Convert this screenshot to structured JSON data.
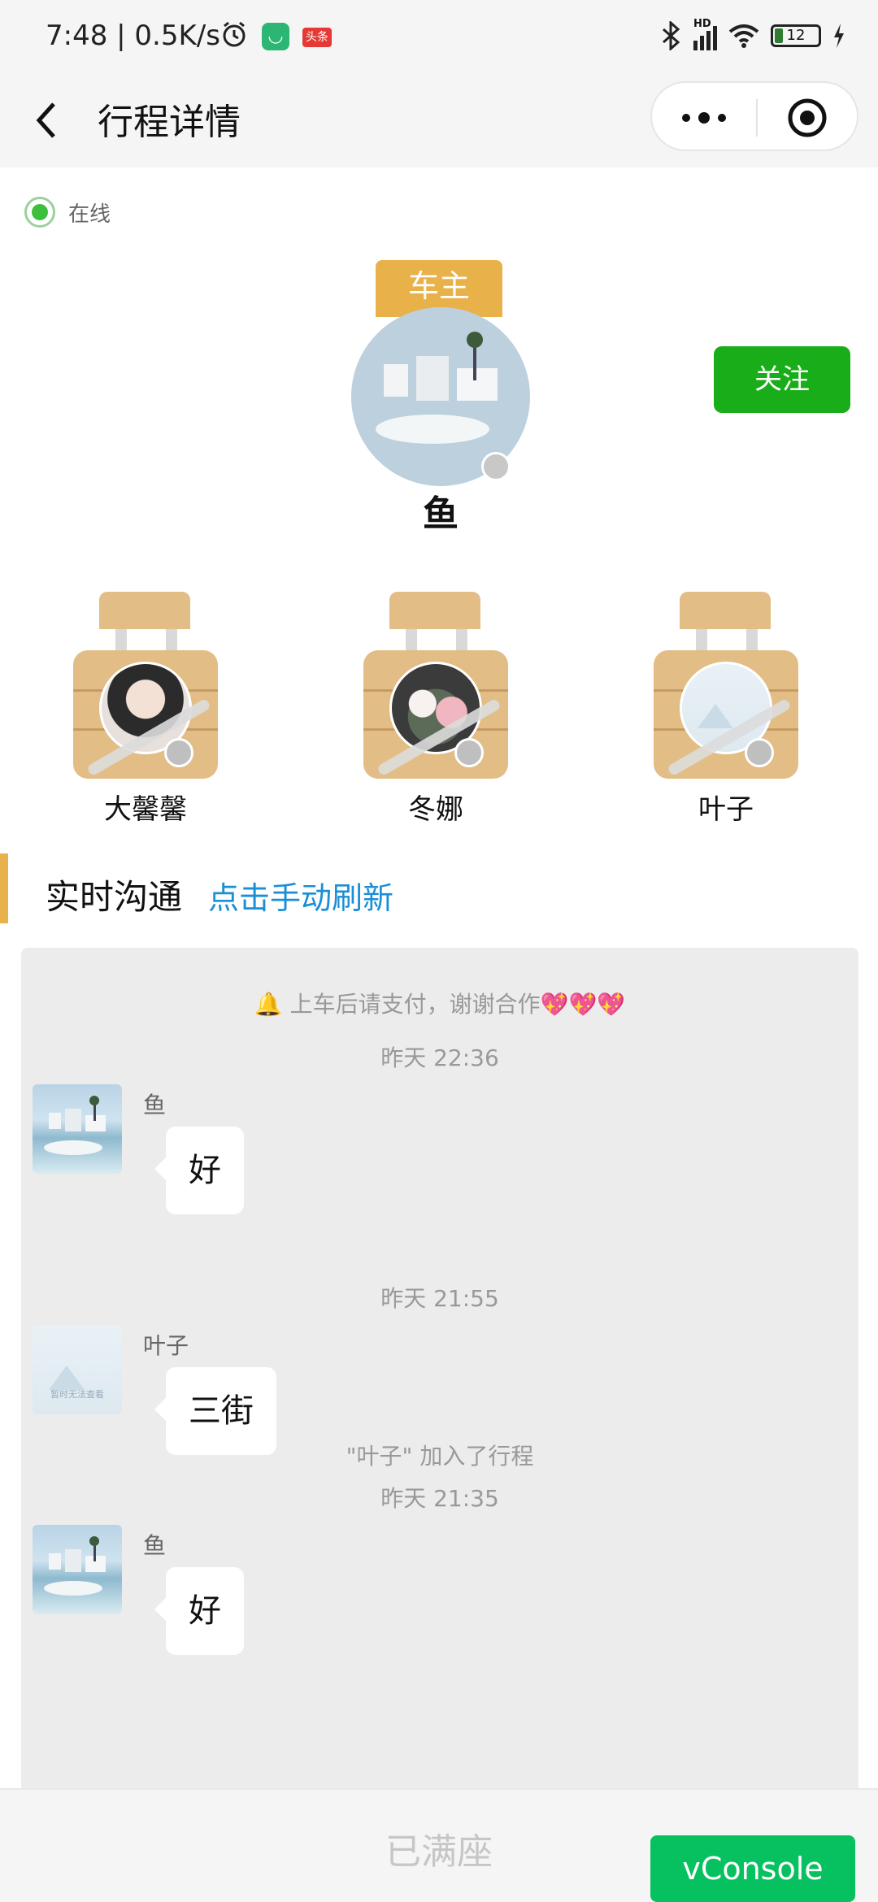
{
  "status_bar": {
    "time": "7:48 | 0.5K/s",
    "app_badge_1": "",
    "app_badge_2": "头条",
    "network": "HD",
    "battery": "12"
  },
  "header": {
    "title": "行程详情"
  },
  "owner": {
    "online_label": "在线",
    "role_tag": "车主",
    "name": "鱼",
    "follow_label": "关注"
  },
  "passengers": [
    {
      "name": "大馨馨"
    },
    {
      "name": "冬娜"
    },
    {
      "name": "叶子"
    }
  ],
  "section": {
    "title": "实时沟通",
    "refresh_link": "点击手动刷新"
  },
  "chat": {
    "notice": "🔔 上车后请支付，谢谢合作💖💖💖",
    "messages": [
      {
        "time": "昨天 22:36",
        "sender": "鱼",
        "text": "好"
      },
      {
        "time": "昨天 21:55",
        "sender": "叶子",
        "text": "三街"
      },
      {
        "system": "\"叶子\" 加入了行程"
      },
      {
        "time": "昨天 21:35",
        "sender": "鱼",
        "text": "好"
      }
    ],
    "placeholder_image_text": "暂时无法查看"
  },
  "bottom": {
    "status_label": "已满座",
    "vconsole_label": "vConsole"
  }
}
